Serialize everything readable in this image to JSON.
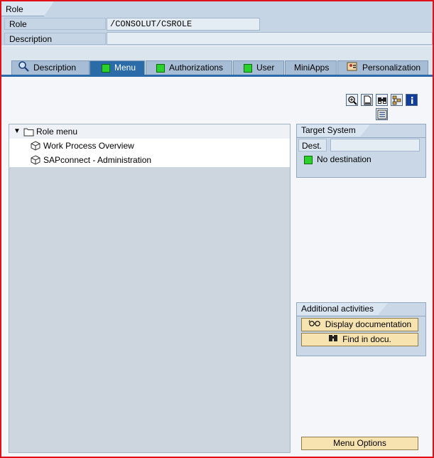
{
  "group": {
    "title": "Role"
  },
  "role_fields": {
    "role_label": "Role",
    "role_value": "/CONSOLUT/CSROLE",
    "description_label": "Description",
    "description_value": ""
  },
  "tabs": [
    {
      "label": "Description",
      "icon": "magnifier-icon",
      "active": false
    },
    {
      "label": "Menu",
      "icon": "green-status-icon",
      "active": true
    },
    {
      "label": "Authorizations",
      "icon": "green-status-icon",
      "active": false
    },
    {
      "label": "User",
      "icon": "green-status-icon",
      "active": false
    },
    {
      "label": "MiniApps",
      "icon": "",
      "active": false
    },
    {
      "label": "Personalization",
      "icon": "personalization-icon",
      "active": false
    }
  ],
  "toolbar": {
    "icons": [
      "zoom-in-icon",
      "document-icon",
      "binoculars-icon",
      "hierarchy-icon",
      "info-icon",
      "list-icon"
    ]
  },
  "tree": {
    "root_label": "Role menu",
    "items": [
      {
        "label": "Work Process Overview"
      },
      {
        "label": "SAPconnect - Administration"
      }
    ]
  },
  "target_system": {
    "title": "Target System",
    "dest_label": "Dest.",
    "dest_value": "",
    "status_text": "No destination",
    "status_color": "#2bd12b"
  },
  "additional": {
    "title": "Additional activities",
    "display_doc": "Display documentation",
    "find_docu": "Find in docu."
  },
  "menu_options": "Menu Options",
  "colors": {
    "frame": "#e0101a",
    "active_tab": "#2b6ca8",
    "button": "#f7e3b0"
  }
}
